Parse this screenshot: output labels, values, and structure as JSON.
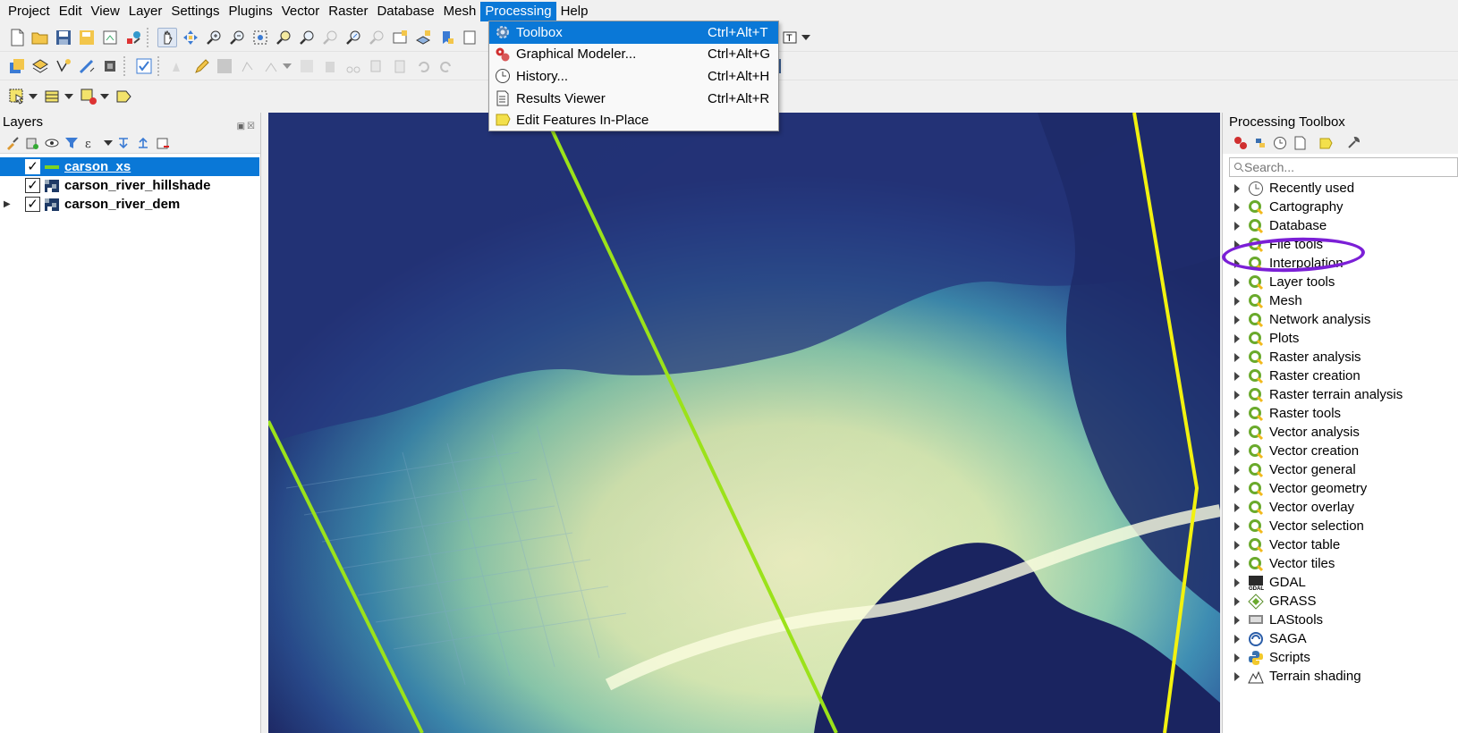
{
  "menubar": {
    "items": [
      "Project",
      "Edit",
      "View",
      "Layer",
      "Settings",
      "Plugins",
      "Vector",
      "Raster",
      "Database",
      "Mesh",
      "Processing",
      "Help"
    ],
    "active_index": 10
  },
  "processing_menu": {
    "items": [
      {
        "label": "Toolbox",
        "shortcut": "Ctrl+Alt+T",
        "icon": "gear-icon",
        "highlighted": true
      },
      {
        "label": "Graphical Modeler...",
        "shortcut": "Ctrl+Alt+G",
        "icon": "model-icon"
      },
      {
        "label": "History...",
        "shortcut": "Ctrl+Alt+H",
        "icon": "clock-icon"
      },
      {
        "label": "Results Viewer",
        "shortcut": "Ctrl+Alt+R",
        "icon": "document-icon"
      },
      {
        "label": "Edit Features In-Place",
        "shortcut": "",
        "icon": "edit-in-place-icon"
      }
    ]
  },
  "layers_panel": {
    "title": "Layers",
    "layers": [
      {
        "name": "carson_xs",
        "checked": true,
        "selected": true,
        "type": "line",
        "expandable": false
      },
      {
        "name": "carson_river_hillshade",
        "checked": true,
        "selected": false,
        "type": "raster",
        "expandable": false
      },
      {
        "name": "carson_river_dem",
        "checked": true,
        "selected": false,
        "type": "raster",
        "expandable": true
      }
    ]
  },
  "toolbox_panel": {
    "title": "Processing Toolbox",
    "search_placeholder": "Search...",
    "groups": [
      {
        "label": "Recently used",
        "icon": "clock-icon"
      },
      {
        "label": "Cartography",
        "icon": "qgis-icon"
      },
      {
        "label": "Database",
        "icon": "qgis-icon"
      },
      {
        "label": "File tools",
        "icon": "qgis-icon"
      },
      {
        "label": "Interpolation",
        "icon": "qgis-icon",
        "annotated": true
      },
      {
        "label": "Layer tools",
        "icon": "qgis-icon"
      },
      {
        "label": "Mesh",
        "icon": "qgis-icon"
      },
      {
        "label": "Network analysis",
        "icon": "qgis-icon"
      },
      {
        "label": "Plots",
        "icon": "qgis-icon"
      },
      {
        "label": "Raster analysis",
        "icon": "qgis-icon"
      },
      {
        "label": "Raster creation",
        "icon": "qgis-icon"
      },
      {
        "label": "Raster terrain analysis",
        "icon": "qgis-icon"
      },
      {
        "label": "Raster tools",
        "icon": "qgis-icon"
      },
      {
        "label": "Vector analysis",
        "icon": "qgis-icon"
      },
      {
        "label": "Vector creation",
        "icon": "qgis-icon"
      },
      {
        "label": "Vector general",
        "icon": "qgis-icon"
      },
      {
        "label": "Vector geometry",
        "icon": "qgis-icon"
      },
      {
        "label": "Vector overlay",
        "icon": "qgis-icon"
      },
      {
        "label": "Vector selection",
        "icon": "qgis-icon"
      },
      {
        "label": "Vector table",
        "icon": "qgis-icon"
      },
      {
        "label": "Vector tiles",
        "icon": "qgis-icon"
      },
      {
        "label": "GDAL",
        "icon": "gdal-icon"
      },
      {
        "label": "GRASS",
        "icon": "grass-icon"
      },
      {
        "label": "LAStools",
        "icon": "lastools-icon"
      },
      {
        "label": "SAGA",
        "icon": "saga-icon"
      },
      {
        "label": "Scripts",
        "icon": "python-icon"
      },
      {
        "label": "Terrain shading",
        "icon": "terrain-icon"
      }
    ]
  },
  "colors": {
    "selection": "#0a78d7",
    "annotation": "#7b1fd6",
    "line_green": "#9be21a",
    "line_yellow": "#f2f20f",
    "dem_low": "#1f2a6b",
    "dem_high": "#f4f8c8"
  }
}
